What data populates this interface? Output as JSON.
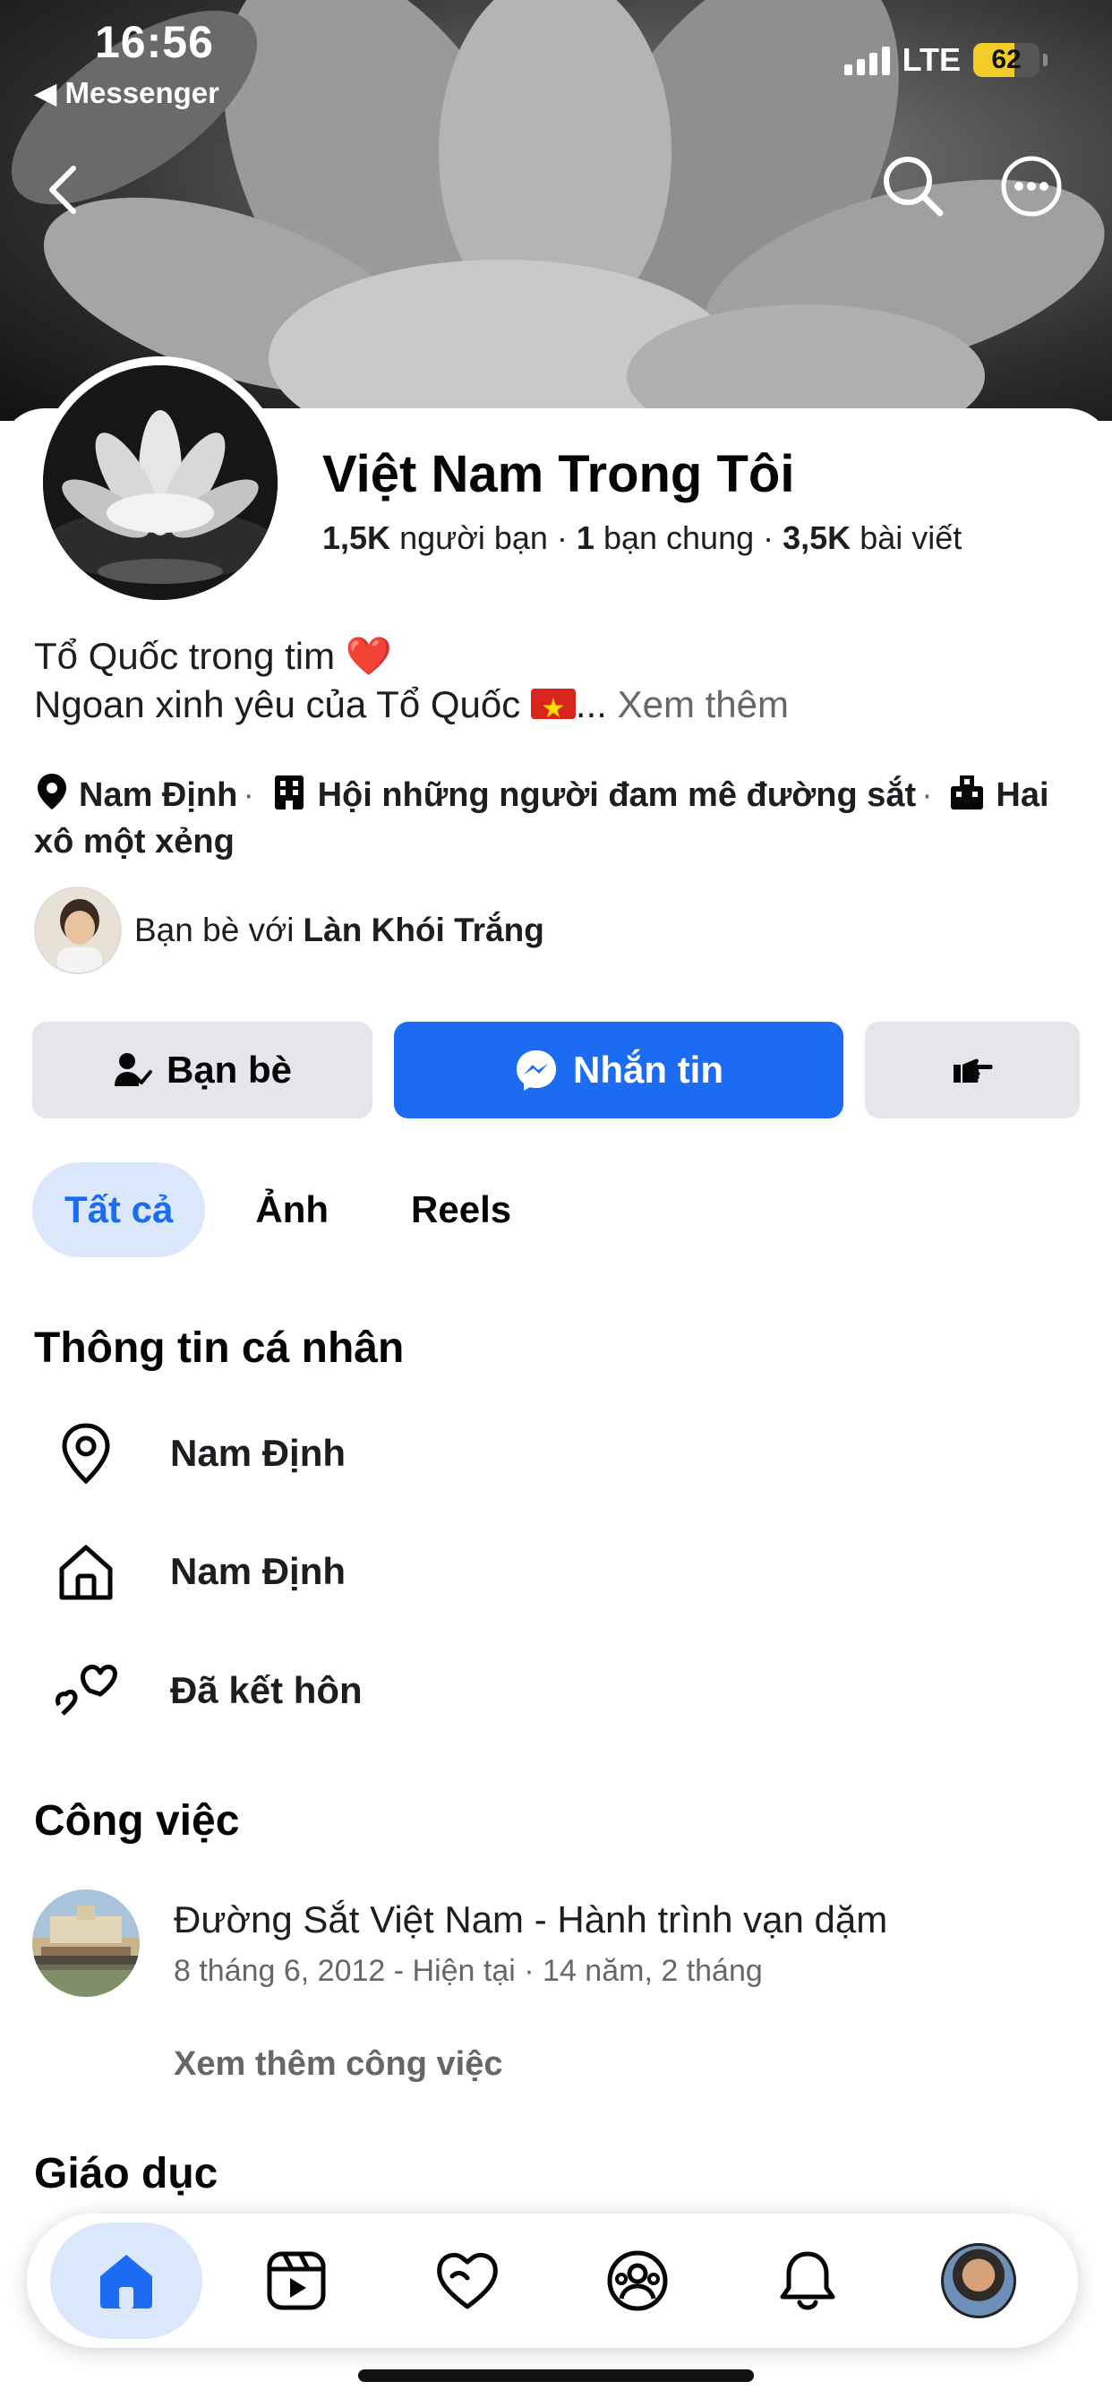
{
  "status_bar": {
    "time": "16:56",
    "back_app": "◀ Messenger",
    "network": "LTE",
    "battery": "62",
    "battery_level": 0.62
  },
  "header": {
    "back_icon": "chevron-left-icon",
    "search_icon": "search-icon",
    "more_icon": "more-icon"
  },
  "profile": {
    "name": "Việt Nam Trong Tôi",
    "friends_count": "1,5K",
    "friends_label": "người bạn",
    "mutual_count": "1",
    "mutual_label": "bạn chung",
    "posts_count": "3,5K",
    "posts_label": "bài viết",
    "bio_line1": "Tổ Quốc trong tim ❤️",
    "bio_line2": "Ngoan xinh yêu của Tổ Quốc",
    "bio_ellipsis": "...",
    "see_more": "Xem thêm",
    "detail_location": "Nam Định",
    "detail_group": "Hội những người đam mê đường sắt",
    "detail_work": "Hai xô một xẻng",
    "mutual_prefix": "Bạn bè với",
    "mutual_name": "Làn Khói Trắng"
  },
  "actions": {
    "friends_button": "Bạn bè",
    "message_button": "Nhắn tin",
    "accent": "#1b6cf2"
  },
  "tabs": [
    {
      "label": "Tất cả",
      "active": true
    },
    {
      "label": "Ảnh",
      "active": false
    },
    {
      "label": "Reels",
      "active": false
    }
  ],
  "personal_info": {
    "title": "Thông tin cá nhân",
    "rows": [
      {
        "icon": "location-pin-icon",
        "text": "Nam Định"
      },
      {
        "icon": "home-icon",
        "text": "Nam Định"
      },
      {
        "icon": "hearts-icon",
        "text": "Đã kết hôn"
      }
    ]
  },
  "work": {
    "title": "Công việc",
    "job_title": "Đường Sắt Việt Nam - Hành trình vạn dặm",
    "job_dates": "8 tháng 6, 2012 - Hiện tại · 14 năm, 2 tháng",
    "see_more": "Xem thêm công việc"
  },
  "education": {
    "title": "Giáo dục"
  },
  "bottom_nav": [
    "home-icon",
    "video-icon",
    "heart-icon",
    "groups-icon",
    "bell-icon",
    "profile-avatar"
  ]
}
